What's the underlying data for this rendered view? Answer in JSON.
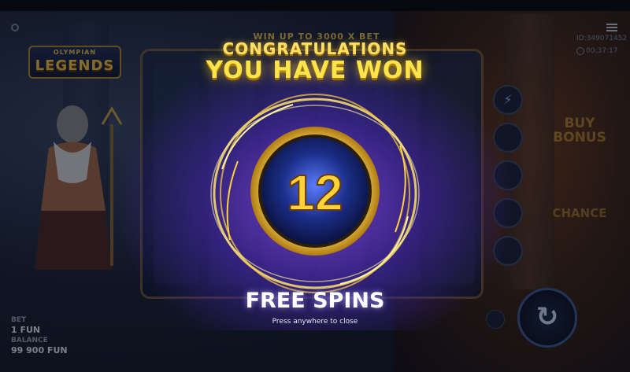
{
  "game": {
    "logo_top": "OLYMPIAN",
    "logo_main": "LEGENDS",
    "win_up_to": "WIN UP TO 3000 X BET",
    "buy_bonus": "BUY BONUS",
    "chance": "CHANCE"
  },
  "hud": {
    "round_id": "ID:349071452",
    "session_time": "00:37:17",
    "bet_label": "BET",
    "bet_value": "1 FUN",
    "balance_label": "BALANCE",
    "balance_value": "99 900 FUN"
  },
  "popup": {
    "congratulations": "CONGRATULATIONS",
    "you_have_won": "YOU HAVE WON",
    "spins_count": "12",
    "free_spins": "FREE SPINS",
    "close_hint": "Press anywhere to close"
  },
  "colors": {
    "gold": "#ffe54a",
    "purple_glow": "#6a3ad8",
    "orb": "#1c2f8a"
  },
  "icons": [
    "gear-icon",
    "menu-icon",
    "clock-icon",
    "lightning-icon",
    "spin-icon"
  ]
}
